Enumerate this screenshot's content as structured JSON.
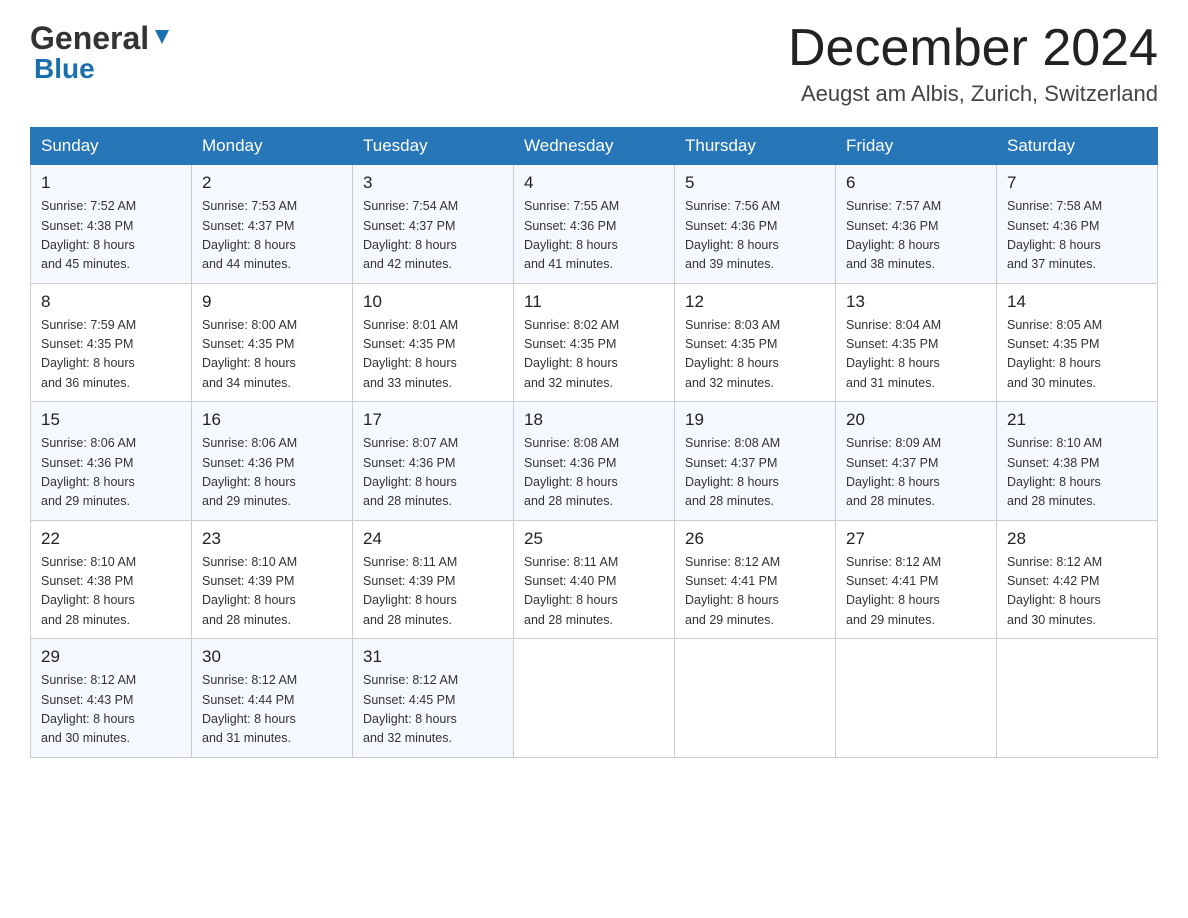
{
  "header": {
    "logo_general": "General",
    "logo_blue": "Blue",
    "month_year": "December 2024",
    "location": "Aeugst am Albis, Zurich, Switzerland"
  },
  "weekdays": [
    "Sunday",
    "Monday",
    "Tuesday",
    "Wednesday",
    "Thursday",
    "Friday",
    "Saturday"
  ],
  "weeks": [
    [
      {
        "day": "1",
        "sunrise": "7:52 AM",
        "sunset": "4:38 PM",
        "daylight": "8 hours and 45 minutes."
      },
      {
        "day": "2",
        "sunrise": "7:53 AM",
        "sunset": "4:37 PM",
        "daylight": "8 hours and 44 minutes."
      },
      {
        "day": "3",
        "sunrise": "7:54 AM",
        "sunset": "4:37 PM",
        "daylight": "8 hours and 42 minutes."
      },
      {
        "day": "4",
        "sunrise": "7:55 AM",
        "sunset": "4:36 PM",
        "daylight": "8 hours and 41 minutes."
      },
      {
        "day": "5",
        "sunrise": "7:56 AM",
        "sunset": "4:36 PM",
        "daylight": "8 hours and 39 minutes."
      },
      {
        "day": "6",
        "sunrise": "7:57 AM",
        "sunset": "4:36 PM",
        "daylight": "8 hours and 38 minutes."
      },
      {
        "day": "7",
        "sunrise": "7:58 AM",
        "sunset": "4:36 PM",
        "daylight": "8 hours and 37 minutes."
      }
    ],
    [
      {
        "day": "8",
        "sunrise": "7:59 AM",
        "sunset": "4:35 PM",
        "daylight": "8 hours and 36 minutes."
      },
      {
        "day": "9",
        "sunrise": "8:00 AM",
        "sunset": "4:35 PM",
        "daylight": "8 hours and 34 minutes."
      },
      {
        "day": "10",
        "sunrise": "8:01 AM",
        "sunset": "4:35 PM",
        "daylight": "8 hours and 33 minutes."
      },
      {
        "day": "11",
        "sunrise": "8:02 AM",
        "sunset": "4:35 PM",
        "daylight": "8 hours and 32 minutes."
      },
      {
        "day": "12",
        "sunrise": "8:03 AM",
        "sunset": "4:35 PM",
        "daylight": "8 hours and 32 minutes."
      },
      {
        "day": "13",
        "sunrise": "8:04 AM",
        "sunset": "4:35 PM",
        "daylight": "8 hours and 31 minutes."
      },
      {
        "day": "14",
        "sunrise": "8:05 AM",
        "sunset": "4:35 PM",
        "daylight": "8 hours and 30 minutes."
      }
    ],
    [
      {
        "day": "15",
        "sunrise": "8:06 AM",
        "sunset": "4:36 PM",
        "daylight": "8 hours and 29 minutes."
      },
      {
        "day": "16",
        "sunrise": "8:06 AM",
        "sunset": "4:36 PM",
        "daylight": "8 hours and 29 minutes."
      },
      {
        "day": "17",
        "sunrise": "8:07 AM",
        "sunset": "4:36 PM",
        "daylight": "8 hours and 28 minutes."
      },
      {
        "day": "18",
        "sunrise": "8:08 AM",
        "sunset": "4:36 PM",
        "daylight": "8 hours and 28 minutes."
      },
      {
        "day": "19",
        "sunrise": "8:08 AM",
        "sunset": "4:37 PM",
        "daylight": "8 hours and 28 minutes."
      },
      {
        "day": "20",
        "sunrise": "8:09 AM",
        "sunset": "4:37 PM",
        "daylight": "8 hours and 28 minutes."
      },
      {
        "day": "21",
        "sunrise": "8:10 AM",
        "sunset": "4:38 PM",
        "daylight": "8 hours and 28 minutes."
      }
    ],
    [
      {
        "day": "22",
        "sunrise": "8:10 AM",
        "sunset": "4:38 PM",
        "daylight": "8 hours and 28 minutes."
      },
      {
        "day": "23",
        "sunrise": "8:10 AM",
        "sunset": "4:39 PM",
        "daylight": "8 hours and 28 minutes."
      },
      {
        "day": "24",
        "sunrise": "8:11 AM",
        "sunset": "4:39 PM",
        "daylight": "8 hours and 28 minutes."
      },
      {
        "day": "25",
        "sunrise": "8:11 AM",
        "sunset": "4:40 PM",
        "daylight": "8 hours and 28 minutes."
      },
      {
        "day": "26",
        "sunrise": "8:12 AM",
        "sunset": "4:41 PM",
        "daylight": "8 hours and 29 minutes."
      },
      {
        "day": "27",
        "sunrise": "8:12 AM",
        "sunset": "4:41 PM",
        "daylight": "8 hours and 29 minutes."
      },
      {
        "day": "28",
        "sunrise": "8:12 AM",
        "sunset": "4:42 PM",
        "daylight": "8 hours and 30 minutes."
      }
    ],
    [
      {
        "day": "29",
        "sunrise": "8:12 AM",
        "sunset": "4:43 PM",
        "daylight": "8 hours and 30 minutes."
      },
      {
        "day": "30",
        "sunrise": "8:12 AM",
        "sunset": "4:44 PM",
        "daylight": "8 hours and 31 minutes."
      },
      {
        "day": "31",
        "sunrise": "8:12 AM",
        "sunset": "4:45 PM",
        "daylight": "8 hours and 32 minutes."
      },
      null,
      null,
      null,
      null
    ]
  ],
  "labels": {
    "sunrise": "Sunrise:",
    "sunset": "Sunset:",
    "daylight": "Daylight:"
  }
}
